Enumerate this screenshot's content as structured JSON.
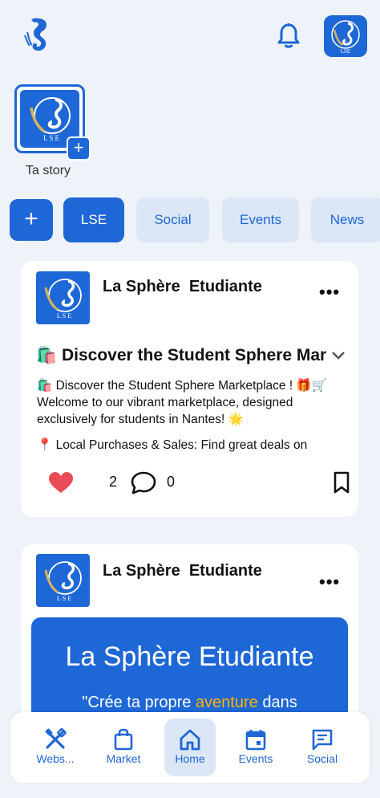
{
  "topbar": {
    "logo_icon": "seahorse-logo-icon",
    "bell_icon": "bell-icon",
    "avatar_initials": "LSE"
  },
  "story": {
    "label": "Ta story",
    "badge_text": "LSE",
    "add_symbol": "+"
  },
  "chips": {
    "add_symbol": "+",
    "items": [
      {
        "label": "LSE",
        "active": true
      },
      {
        "label": "Social",
        "active": false
      },
      {
        "label": "Events",
        "active": false
      },
      {
        "label": "News",
        "active": false
      }
    ]
  },
  "posts": [
    {
      "author": "La Sphère  Etudiante",
      "avatar_text": "LSE",
      "title": "🛍️ Discover the Student Sphere Marketplace",
      "body": [
        "🛍️ Discover the Student Sphere Marketplace ! 🎁🛒",
        " Welcome to our vibrant marketplace, designed",
        "exclusively for students in Nantes! 🌟",
        "📍 Local Purchases & Sales: Find great deals on"
      ],
      "likes": "2",
      "comments": "0"
    },
    {
      "author": "La Sphère  Etudiante",
      "avatar_text": "LSE",
      "banner_title": "La Sphère Etudiante",
      "banner_sub_before": "\"Crée ta propre ",
      "banner_sub_highlight": "aventure",
      "banner_sub_after": " dans"
    }
  ],
  "colors": {
    "accent": "#1e67d6",
    "chip_bg": "#dbe6f7",
    "like": "#e94b57",
    "highlight": "#ffb300"
  },
  "bottom_nav": [
    {
      "label": "Webs...",
      "icon": "tools-icon",
      "active": false
    },
    {
      "label": "Market",
      "icon": "shopping-bag-icon",
      "active": false
    },
    {
      "label": "Home",
      "icon": "home-icon",
      "active": true
    },
    {
      "label": "Events",
      "icon": "calendar-icon",
      "active": false
    },
    {
      "label": "Social",
      "icon": "chat-icon",
      "active": false
    }
  ]
}
